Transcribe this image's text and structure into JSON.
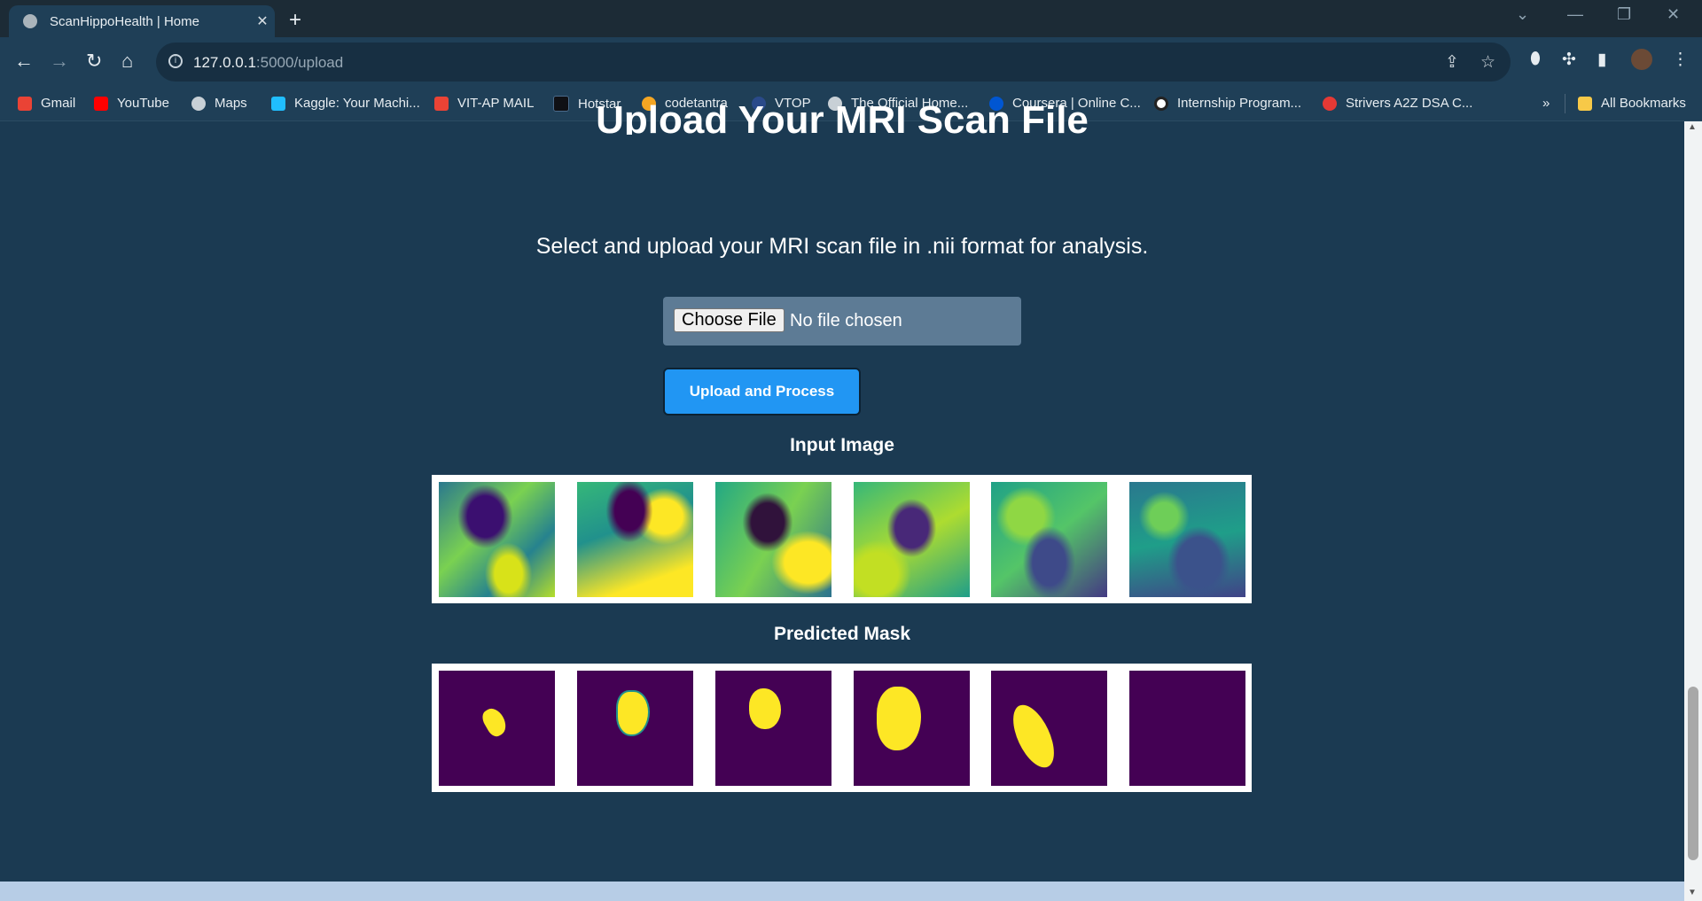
{
  "browser": {
    "tab_title": "ScanHippoHealth | Home",
    "tab_close": "✕",
    "new_tab": "+",
    "url_host": "127.0.0.1",
    "url_path": ":5000/upload"
  },
  "bookmarks": [
    {
      "label": "Gmail",
      "icon_color": "#ea4335",
      "icon": "gmail-icon"
    },
    {
      "label": "YouTube",
      "icon_color": "#ff0000",
      "icon": "youtube-icon"
    },
    {
      "label": "Maps",
      "icon_color": "#c8d0d6",
      "icon": "globe-icon"
    },
    {
      "label": "Kaggle: Your Machi...",
      "icon_color": "#20beff",
      "icon": "kaggle-icon"
    },
    {
      "label": "VIT-AP MAIL",
      "icon_color": "#ea4335",
      "icon": "gmail-icon"
    },
    {
      "label": "Hotstar",
      "icon_color": "#0f1014",
      "icon": "hotstar-icon"
    },
    {
      "label": "codetantra",
      "icon_color": "#f5a623",
      "icon": "codetantra-icon"
    },
    {
      "label": "VTOP",
      "icon_color": "#2a4a8a",
      "icon": "vtop-icon"
    },
    {
      "label": "The Official Home...",
      "icon_color": "#c8d0d6",
      "icon": "globe-icon"
    },
    {
      "label": "Coursera | Online C...",
      "icon_color": "#0056d2",
      "icon": "coursera-icon"
    },
    {
      "label": "Internship Program...",
      "icon_color": "#ffffff",
      "icon": "internship-icon"
    },
    {
      "label": "Strivers A2Z DSA C...",
      "icon_color": "#e53935",
      "icon": "tuf-icon"
    }
  ],
  "bookmarks_overflow": "»",
  "all_bookmarks": "All Bookmarks",
  "page": {
    "title": "Upload Your MRI Scan File",
    "subtitle": "Select and upload your MRI scan file in .nii format for analysis.",
    "choose_file_label": "Choose File",
    "no_file_label": "No file chosen",
    "upload_button": "Upload and Process",
    "input_heading": "Input Image",
    "mask_heading": "Predicted Mask"
  },
  "colors": {
    "page_bg": "#1b3a52",
    "button_blue": "#2196f3",
    "mask_bg": "#440154",
    "mask_fg": "#fde725"
  }
}
